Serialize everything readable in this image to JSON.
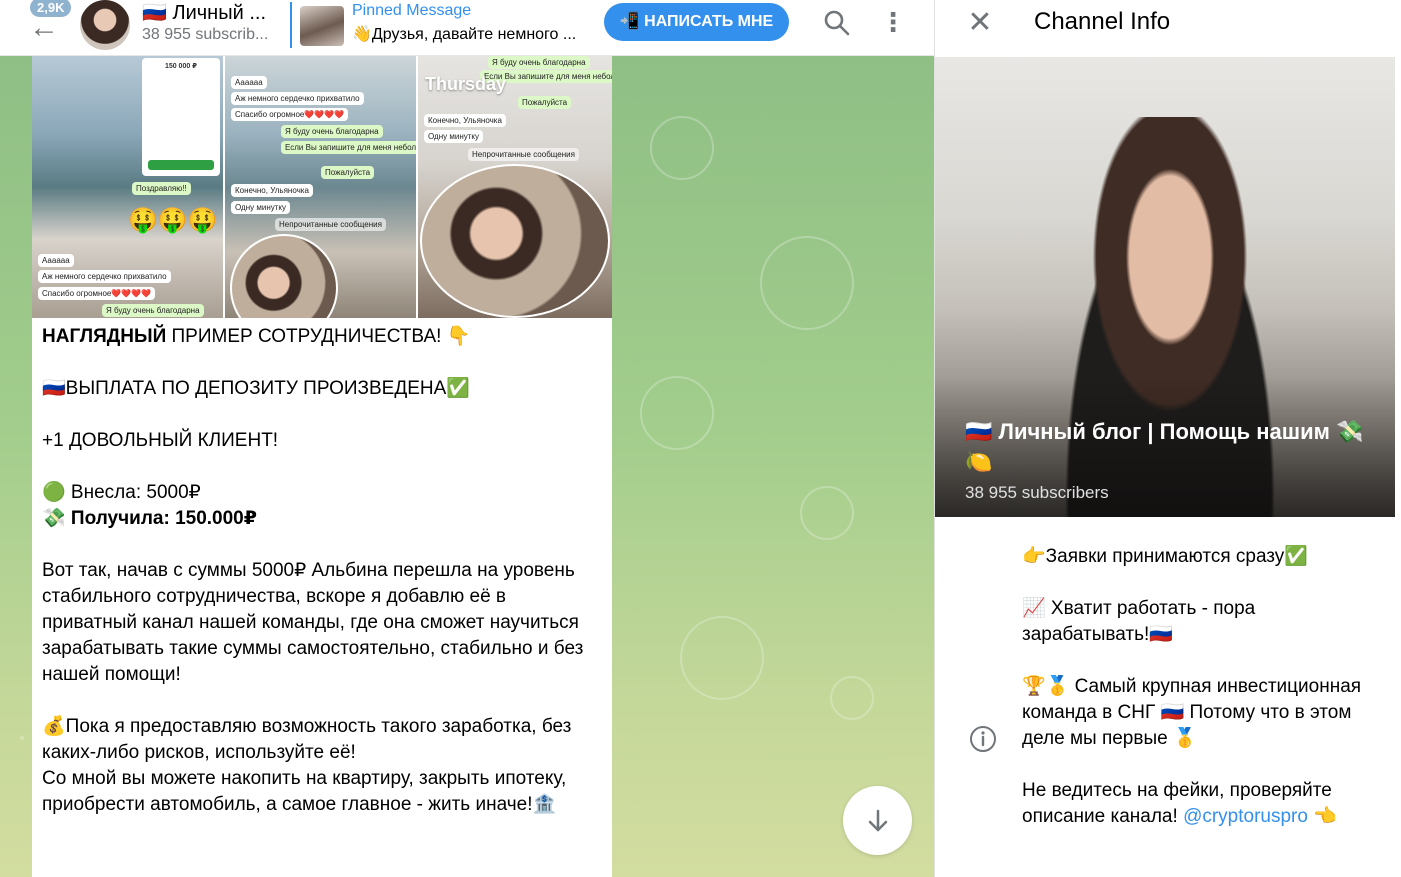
{
  "header": {
    "unread_count": "2,9K",
    "chat_title": "🇷🇺 Личный ...",
    "chat_subtitle": "38 955 subscrib...",
    "pinned_label": "Pinned Message",
    "pinned_text": "👋Друзья, давайте немного ...",
    "write_button": "📲 НАПИСАТЬ МНЕ"
  },
  "post": {
    "screenshots": {
      "phone_amount": "150 000 ₽",
      "day_label": "Thursday",
      "s1_messages": [
        "Поздравляю!!",
        "Аааааа",
        "Аж немного сердечко прихватило",
        "Спасибо огромное❤️❤️❤️❤️",
        "Я буду очень благодарна"
      ],
      "s2_messages": [
        "Аааааа",
        "Аж немного сердечко прихватило",
        "Спасибо огромное❤️❤️❤️❤️",
        "Я буду очень благодарна",
        "Если Вы запишите для меня небольшой видео-отзыв",
        "Пожалуйста",
        "Конечно, Ульяночка",
        "Одну минутку",
        "Непрочитанные сообщения"
      ],
      "s3_messages": [
        "Я буду очень благодарна",
        "Если Вы запишите для меня небольшой видео-отзыв",
        "Пожалуйста",
        "Конечно, Ульяночка",
        "Одну минутку",
        "Непрочитанные сообщения"
      ],
      "emojis": "🤑🤑🤑"
    },
    "line1_bold": "НАГЛЯДНЫЙ",
    "line1_rest": " ПРИМЕР СОТРУДНИЧЕСТВА! 👇",
    "line2": "🇷🇺ВЫПЛАТА ПО ДЕПОЗИТУ ПРОИЗВЕДЕНА✅",
    "line3": "+1 ДОВОЛЬНЫЙ КЛИЕНТ!",
    "line4": "🟢 Внесла: 5000₽",
    "line5": "💸 Получила: 150.000₽",
    "para1": "Вот так, начав с суммы 5000₽ Альбина перешла на уровень стабильного сотрудничества, вскоре я добавлю её в приватный канал нашей команды, где она сможет научиться зарабатывать такие суммы самостоятельно, стабильно и без нашей помощи!",
    "para2a": "💰Пока я предоставляю возможность такого заработка, без каких-либо рисков, используйте её!",
    "para2b": "Со мной вы можете накопить на квартиру, закрыть ипотеку, приобрести автомобиль, а самое главное - жить иначе!🏦"
  },
  "side": {
    "title": "Channel Info",
    "channel_name": "🇷🇺 Личный блог | Помощь нашим 💸🍋",
    "subscribers": "38 955 subscribers",
    "desc1": "👉Заявки принимаются сразу✅",
    "desc2": "📈 Хватит работать - пора зарабатывать!🇷🇺",
    "desc3": "🏆🥇 Самый крупная инвестиционная команда в СНГ 🇷🇺 Потому что в этом деле мы первые 🥇",
    "desc4": "Не ведитесь на фейки, проверяйте описание канала! ",
    "desc4_link": "@cryptoruspro",
    "desc4_end": " 👈"
  },
  "colors": {
    "accent": "#3390ec",
    "chat_bg": "#a2cd8c",
    "bubble": "#ffffff"
  }
}
